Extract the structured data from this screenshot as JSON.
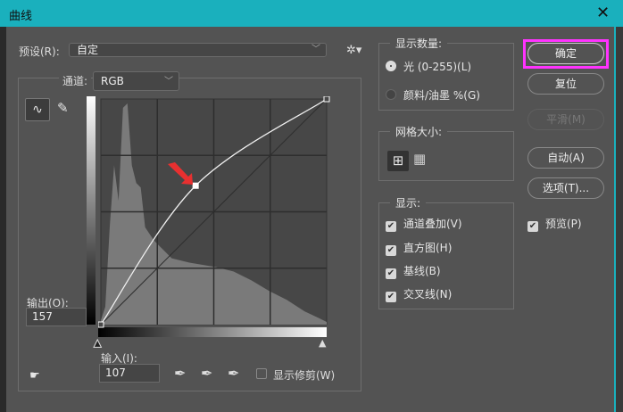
{
  "window": {
    "title": "曲线",
    "close": "✕"
  },
  "preset": {
    "label": "预设(R):",
    "value": "自定"
  },
  "channel": {
    "label": "通道:",
    "value": "RGB"
  },
  "output": {
    "label": "输出(O):",
    "value": "157"
  },
  "input": {
    "label": "输入(I):",
    "value": "107"
  },
  "show_clipping": {
    "label": "显示修剪(W)",
    "checked": false
  },
  "curve": {
    "points": [
      [
        0,
        0
      ],
      [
        107,
        157
      ],
      [
        255,
        255
      ]
    ],
    "selected_point": [
      107,
      157
    ]
  },
  "display_amount": {
    "title": "显示数量:",
    "options": [
      {
        "label": "光 (0-255)(L)",
        "selected": true
      },
      {
        "label": "颜料/油墨 %(G)",
        "selected": false
      }
    ]
  },
  "grid_size": {
    "title": "网格大小:"
  },
  "show": {
    "title": "显示:",
    "options": [
      {
        "label": "通道叠加(V)",
        "checked": true
      },
      {
        "label": "直方图(H)",
        "checked": true
      },
      {
        "label": "基线(B)",
        "checked": true
      },
      {
        "label": "交叉线(N)",
        "checked": true
      }
    ]
  },
  "buttons": {
    "ok": "确定",
    "reset": "复位",
    "smooth": "平滑(M)",
    "auto": "自动(A)",
    "options": "选项(T)..."
  },
  "preview": {
    "label": "预览(P)",
    "checked": true
  },
  "colors": {
    "title_bar": "#1ab0bd",
    "highlight": "#ff33ff",
    "arrow": "#e83030"
  }
}
